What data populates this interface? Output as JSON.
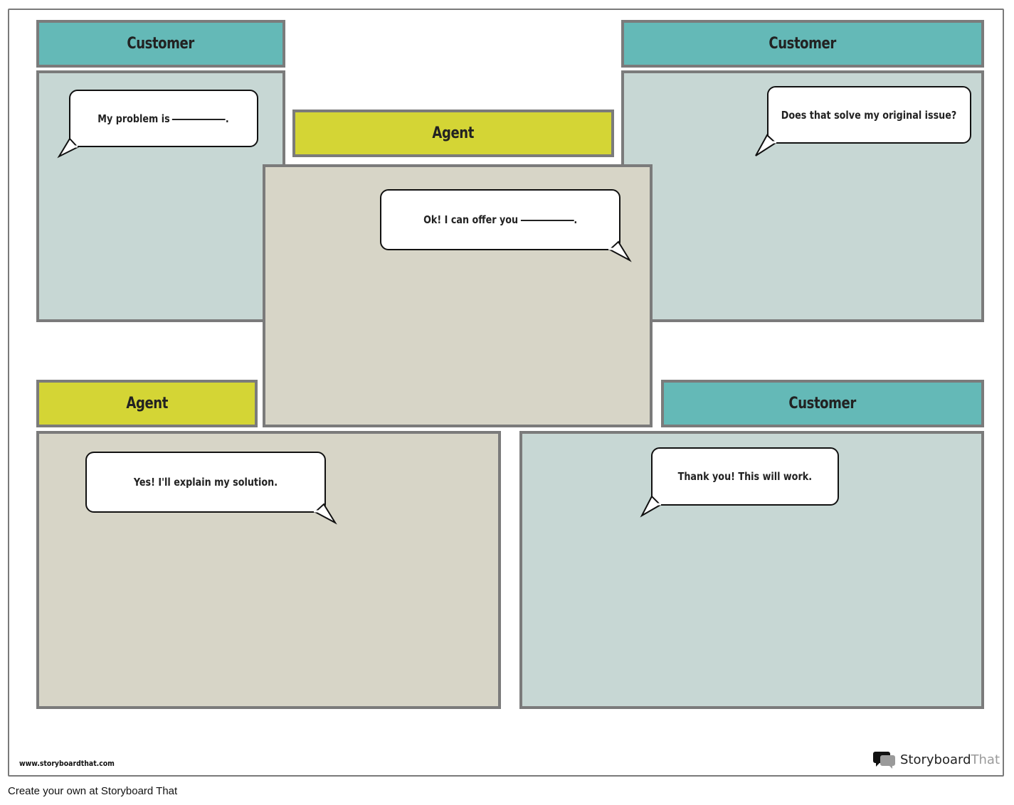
{
  "panels": [
    {
      "role": "Customer",
      "speech": "My problem is",
      "has_blank": true
    },
    {
      "role": "Agent",
      "speech": "Ok! I can offer you",
      "has_blank": true
    },
    {
      "role": "Customer",
      "speech": "Does that solve my original issue?",
      "has_blank": false
    },
    {
      "role": "Agent",
      "speech": "Yes! I'll explain my solution.",
      "has_blank": false
    },
    {
      "role": "Customer",
      "speech": "Thank you! This will work.",
      "has_blank": false
    }
  ],
  "blank_suffix": ".",
  "colors": {
    "customer_label": "#64b9b7",
    "agent_label": "#d4d535",
    "customer_panel": "#c7d7d4",
    "agent_panel": "#d7d5c7",
    "border": "#7b7b7b"
  },
  "footer": {
    "url": "www.storyboardthat.com",
    "brand_main": "Storyboard",
    "brand_accent": "That",
    "brand_icon": "speech-bubbles-icon",
    "create_link": "Create your own at Storyboard That"
  }
}
